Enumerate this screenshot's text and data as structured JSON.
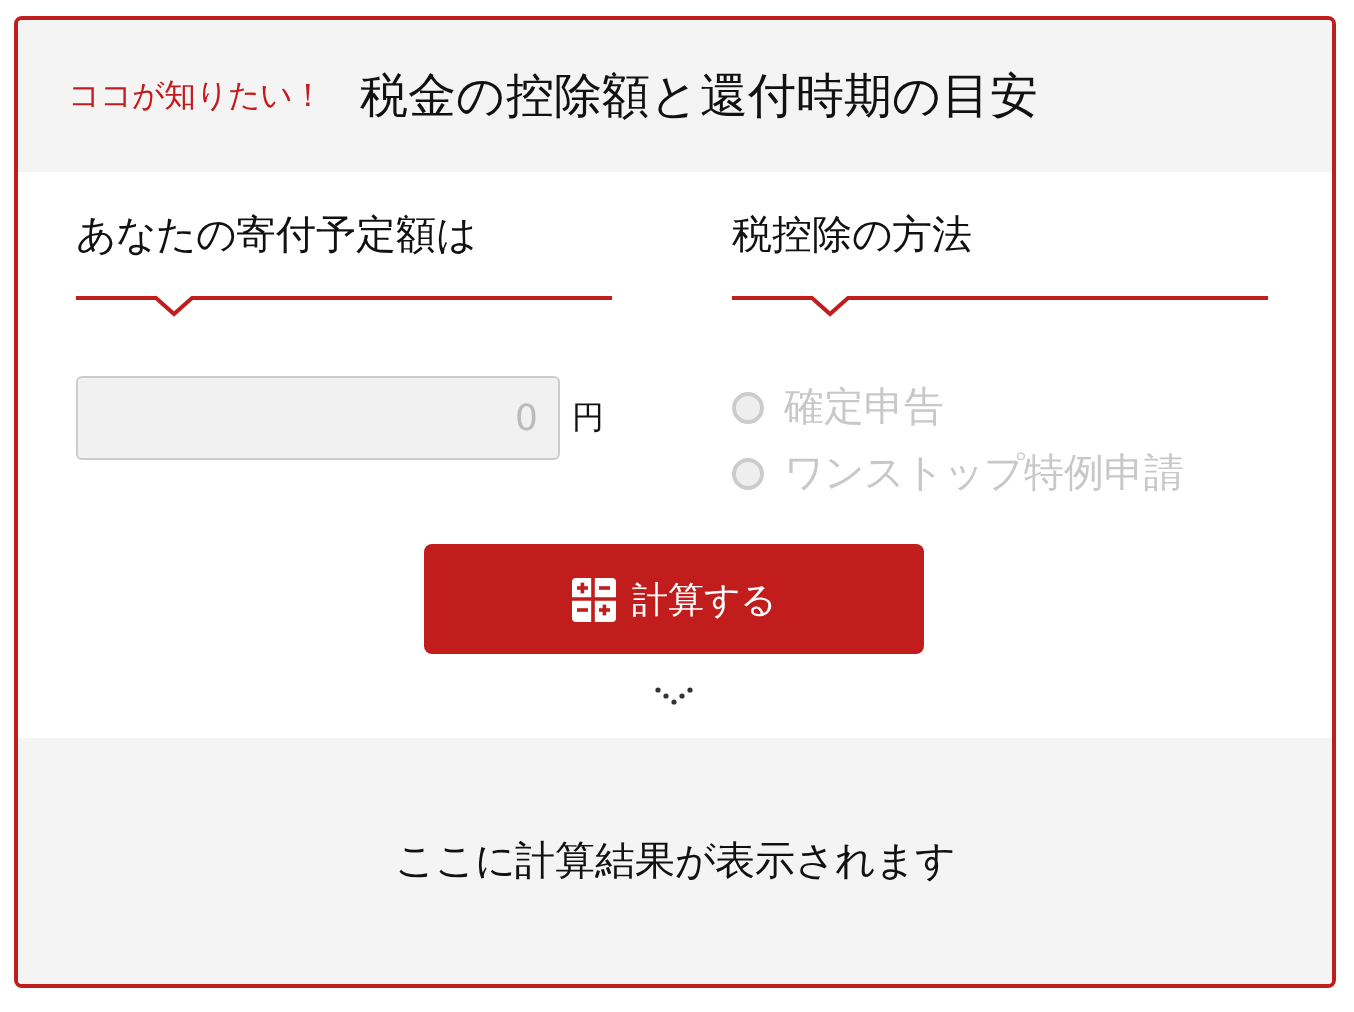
{
  "header": {
    "tag": "ココが知りたい！",
    "title": "税金の控除額と還付時期の目安"
  },
  "amount": {
    "heading": "あなたの寄付予定額は",
    "value": "0",
    "unit": "円",
    "disabled": true
  },
  "method": {
    "heading": "税控除の方法",
    "options": [
      {
        "label": "確定申告",
        "selected": false,
        "disabled": true
      },
      {
        "label": "ワンストップ特例申請",
        "selected": false,
        "disabled": true
      }
    ]
  },
  "button": {
    "label": "計算する"
  },
  "result": {
    "text": "ここに計算結果が表示されます"
  }
}
